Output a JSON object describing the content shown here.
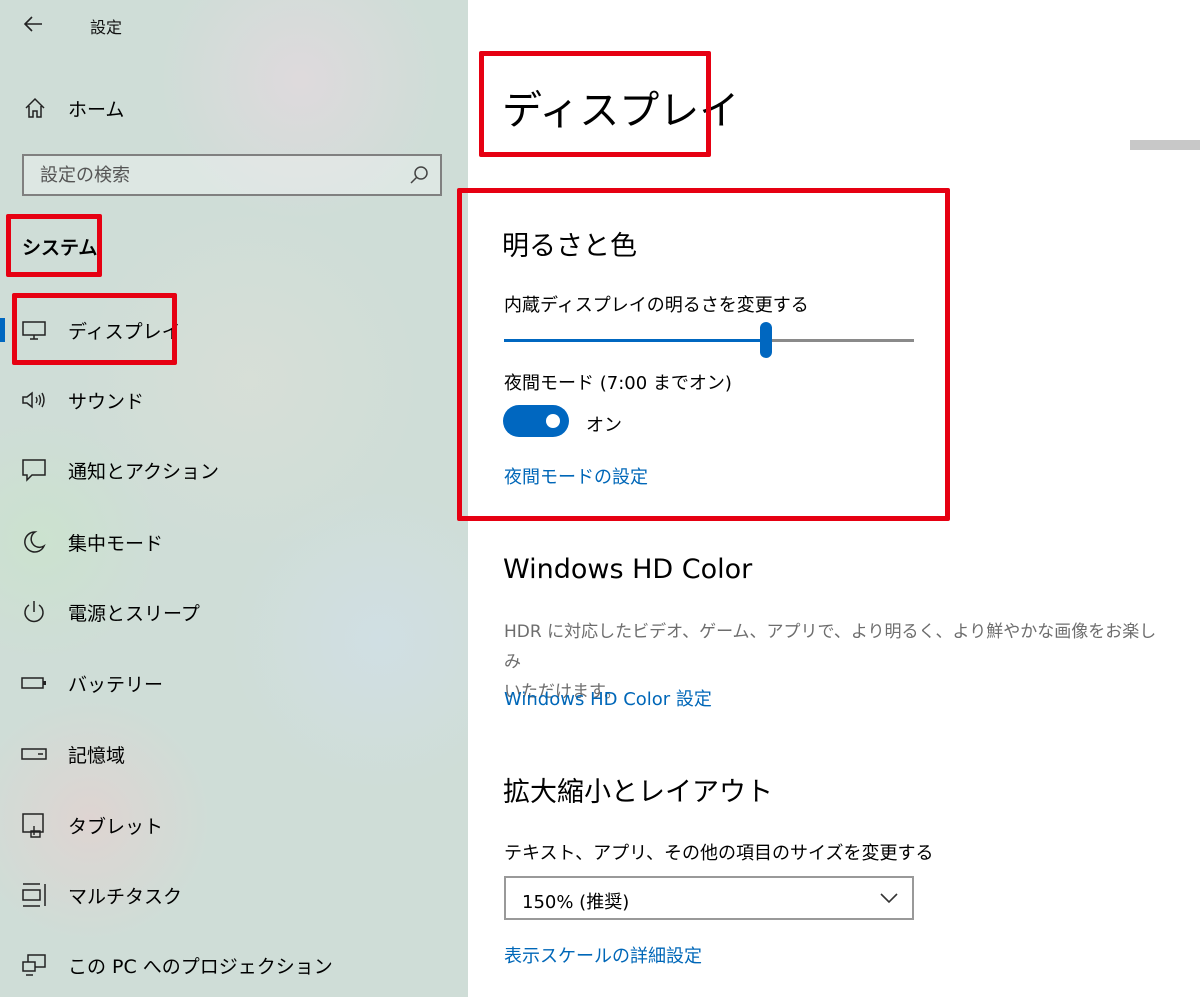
{
  "header": {
    "title": "設定"
  },
  "sidebar": {
    "home_label": "ホーム",
    "search_placeholder": "設定の検索",
    "section_label": "システム",
    "items": [
      {
        "label": "ディスプレイ",
        "icon": "monitor-icon",
        "selected": true
      },
      {
        "label": "サウンド",
        "icon": "speaker-icon"
      },
      {
        "label": "通知とアクション",
        "icon": "notification-icon"
      },
      {
        "label": "集中モード",
        "icon": "moon-icon"
      },
      {
        "label": "電源とスリープ",
        "icon": "power-icon"
      },
      {
        "label": "バッテリー",
        "icon": "battery-icon"
      },
      {
        "label": "記憶域",
        "icon": "storage-icon"
      },
      {
        "label": "タブレット",
        "icon": "tablet-icon"
      },
      {
        "label": "マルチタスク",
        "icon": "multitask-icon"
      },
      {
        "label": "この PC へのプロジェクション",
        "icon": "projection-icon"
      }
    ]
  },
  "main": {
    "page_title": "ディスプレイ",
    "brightness": {
      "heading": "明るさと色",
      "slider_label": "内蔵ディスプレイの明るさを変更する",
      "slider_value": 0.64,
      "night_mode_label": "夜間モード (7:00 までオン)",
      "night_mode_state": "オン",
      "night_mode_on": true,
      "night_mode_link": "夜間モードの設定"
    },
    "hdr": {
      "heading": "Windows HD Color",
      "description_line1": "HDR に対応したビデオ、ゲーム、アプリで、より明るく、より鮮やかな画像をお楽しみ",
      "description_line2": "いただけます。",
      "link": "Windows HD Color 設定"
    },
    "scale": {
      "heading": "拡大縮小とレイアウト",
      "label": "テキスト、アプリ、その他の項目のサイズを変更する",
      "selected_value": "150% (推奨)",
      "link": "表示スケールの詳細設定"
    }
  },
  "colors": {
    "accent": "#0067c0",
    "link": "#0067b8",
    "highlight": "#e60012"
  }
}
